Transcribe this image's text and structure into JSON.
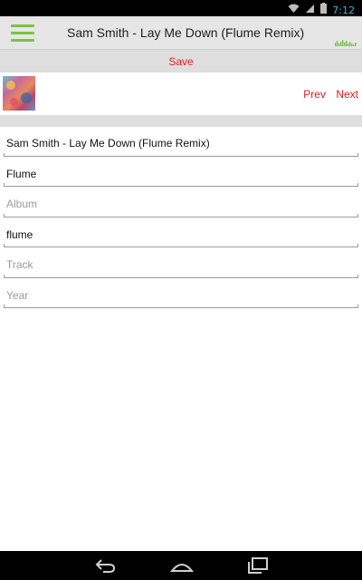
{
  "status_bar": {
    "time": "7:12"
  },
  "action_bar": {
    "title": "Sam Smith - Lay Me Down (Flume Remix)",
    "colors": {
      "menu_icon": "#7cc242"
    }
  },
  "save_bar": {
    "save_label": "Save"
  },
  "track_row": {
    "prev_label": "Prev",
    "next_label": "Next"
  },
  "fields": [
    {
      "name": "title",
      "value": "Sam Smith - Lay Me Down (Flume Remix)",
      "placeholder": ""
    },
    {
      "name": "artist",
      "value": "Flume",
      "placeholder": ""
    },
    {
      "name": "album",
      "value": "",
      "placeholder": "Album"
    },
    {
      "name": "genre",
      "value": "flume",
      "placeholder": ""
    },
    {
      "name": "track",
      "value": "",
      "placeholder": "Track"
    },
    {
      "name": "year",
      "value": "",
      "placeholder": "Year"
    }
  ],
  "colors": {
    "accent_red": "#e02020",
    "accent_green": "#7cc242"
  }
}
